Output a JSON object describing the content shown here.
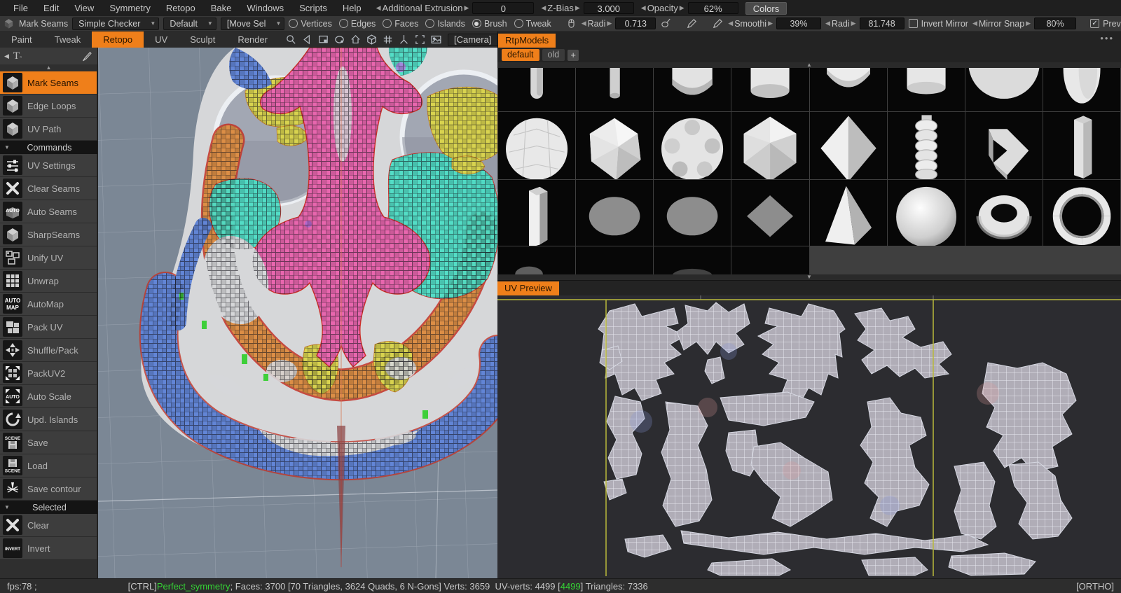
{
  "colors": {
    "accent": "#ef7f1a",
    "status_green": "#35d435",
    "uv_yellow": "#b9ba3a",
    "viewport_bg": "#7b8795",
    "seam_red": "#d0302a"
  },
  "menu": {
    "items": [
      "File",
      "Edit",
      "View",
      "Symmetry",
      "Retopo",
      "Bake",
      "Windows",
      "Scripts",
      "Help"
    ]
  },
  "top_controls": {
    "additional_extrusion": {
      "label": "Additional Extrusion",
      "value": "0"
    },
    "z_bias": {
      "label": "Z-Bias",
      "value": "3.000"
    },
    "opacity": {
      "label": "Opacity",
      "value": "62%"
    },
    "colors_button": "Colors"
  },
  "toolbar": {
    "tool_label": "Mark Seams",
    "checker_dropdown": "Simple Checker",
    "preset_dropdown": "Default",
    "move_dropdown": "[Move Sel",
    "select_modes": [
      {
        "label": "Vertices",
        "selected": false
      },
      {
        "label": "Edges",
        "selected": false
      },
      {
        "label": "Faces",
        "selected": false
      },
      {
        "label": "Islands",
        "selected": false
      },
      {
        "label": "Brush",
        "selected": true
      },
      {
        "label": "Tweak",
        "selected": false
      }
    ],
    "radius1": {
      "label": "Radi",
      "value": "0.713"
    },
    "smoothing": {
      "label": "Smoothi",
      "value": "39%"
    },
    "radius2": {
      "label": "Radi",
      "value": "81.748"
    },
    "invert_mirror": {
      "label": "Invert Mirror",
      "checked": false
    },
    "mirror_snap": {
      "label": "Mirror Snap",
      "value": "80%"
    },
    "preview_islands": {
      "label": "Preview Islands",
      "checked": true
    }
  },
  "workspace": {
    "tabs": [
      {
        "label": "Paint",
        "active": false
      },
      {
        "label": "Tweak",
        "active": false
      },
      {
        "label": "Retopo",
        "active": true
      },
      {
        "label": "UV",
        "active": false
      },
      {
        "label": "Sculpt",
        "active": false
      },
      {
        "label": "Render",
        "active": false
      }
    ],
    "view_icons": [
      "zoom",
      "select",
      "frame",
      "rotate",
      "home",
      "cube",
      "grid",
      "axes",
      "expand",
      "snapshot"
    ],
    "camera_label": "[Camera]"
  },
  "sidebar": {
    "items": [
      {
        "type": "tool",
        "label": "Mark Seams",
        "icon": "cube",
        "active": true
      },
      {
        "type": "tool",
        "label": "Edge Loops",
        "icon": "cube"
      },
      {
        "type": "tool",
        "label": "UV Path",
        "icon": "cube"
      },
      {
        "type": "header",
        "label": "Commands"
      },
      {
        "type": "tool",
        "label": "UV Settings",
        "icon": "sliders"
      },
      {
        "type": "tool",
        "label": "Clear Seams",
        "icon": "x"
      },
      {
        "type": "tool",
        "label": "Auto Seams",
        "icon": "auto"
      },
      {
        "type": "tool",
        "label": "SharpSeams",
        "icon": "cube"
      },
      {
        "type": "tool",
        "label": "Unify UV",
        "icon": "unify"
      },
      {
        "type": "tool",
        "label": "Unwrap",
        "icon": "grid"
      },
      {
        "type": "tool",
        "label": "AutoMap",
        "icon": "automap"
      },
      {
        "type": "tool",
        "label": "Pack UV",
        "icon": "pack"
      },
      {
        "type": "tool",
        "label": "Shuffle/Pack",
        "icon": "shuffle"
      },
      {
        "type": "tool",
        "label": "PackUV2",
        "icon": "packuv2"
      },
      {
        "type": "tool",
        "label": "Auto Scale",
        "icon": "autoscale"
      },
      {
        "type": "tool",
        "label": "Upd. Islands",
        "icon": "refresh"
      },
      {
        "type": "tool",
        "label": "Save",
        "icon": "save-scene"
      },
      {
        "type": "tool",
        "label": "Load",
        "icon": "load-scene"
      },
      {
        "type": "tool",
        "label": "Save contour",
        "icon": "spark"
      },
      {
        "type": "header",
        "label": "Selected"
      },
      {
        "type": "tool",
        "label": "Clear",
        "icon": "x"
      },
      {
        "type": "tool",
        "label": "Invert",
        "icon": "invert"
      }
    ]
  },
  "rtp_models": {
    "title": "RtpModels",
    "tabs": [
      {
        "label": "default",
        "active": true
      },
      {
        "label": "old",
        "active": false
      }
    ],
    "add_label": "+",
    "shapes": [
      "capsule",
      "cylinder-thin",
      "cylinder-dome",
      "cylinder",
      "cylinder-round",
      "cylinder-short",
      "hemisphere",
      "egg",
      "sphere-faceted",
      "gem",
      "ball-faceted",
      "icosahedron",
      "octahedron",
      "bead-stack",
      "elbow",
      "hex-column",
      "prism",
      "disc",
      "disc",
      "diamond-flat",
      "pyramid",
      "sphere",
      "torus",
      "spiral-shell"
    ]
  },
  "uv_preview": {
    "title": "UV Preview"
  },
  "status_bar": {
    "fps": "fps:78 ;",
    "ctrl": "[CTRL]",
    "symmetry": "Perfect_symmetry",
    "stats_a": "; Faces: 3700 [70 Triangles, 3624 Quads, 6 N-Gons] Verts: 3659  UV-verts: 4499 [",
    "uv_selected": "4499",
    "stats_b": "] Triangles: 7336",
    "ortho": "[ORTHO]"
  }
}
